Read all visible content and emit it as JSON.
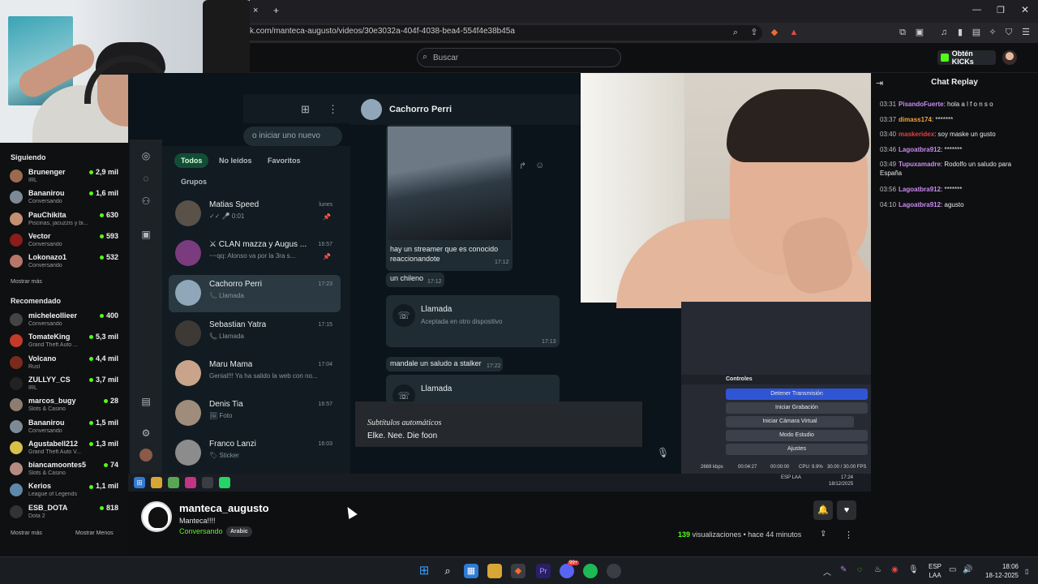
{
  "browser": {
    "url": "k.com/manteca-augusto/videos/30e3032a-404f-4038-bea4-554f4e38b45a",
    "tab_add": "+",
    "tab_close": "×"
  },
  "header": {
    "search_placeholder": "Buscar",
    "get_kicks": "Obtén KICKs"
  },
  "sidebar": {
    "following_title": "Siguiendo",
    "following": [
      {
        "name": "Brunenger",
        "sub": "IRL",
        "viewers": "2,9 mil",
        "color": "#9c6b4e"
      },
      {
        "name": "Bananirou",
        "sub": "Conversando",
        "viewers": "1,6 mil",
        "color": "#7d8a95"
      },
      {
        "name": "PauChikita",
        "sub": "Piscinas, jacuzzis y bi...",
        "viewers": "630",
        "color": "#c58f72"
      },
      {
        "name": "Vector",
        "sub": "Conversando",
        "viewers": "593",
        "color": "#8a1d1d"
      },
      {
        "name": "Lokonazo1",
        "sub": "Conversando",
        "viewers": "532",
        "color": "#b7766a"
      }
    ],
    "show_more_1": "Mostrar más",
    "recommended_title": "Recomendado",
    "recommended": [
      {
        "name": "micheleollieer",
        "sub": "Conversando",
        "viewers": "400",
        "color": "#444"
      },
      {
        "name": "TomateKing",
        "sub": "Grand Theft Auto ...",
        "viewers": "5,3 mil",
        "color": "#c23b2a"
      },
      {
        "name": "Volcano",
        "sub": "Rust",
        "viewers": "4,4 mil",
        "color": "#7a2b1c"
      },
      {
        "name": "ZULLYY_CS",
        "sub": "IRL",
        "viewers": "3,7 mil",
        "color": "#222"
      },
      {
        "name": "marcos_bugy",
        "sub": "Slots & Casino",
        "viewers": "28",
        "color": "#8c7d70"
      },
      {
        "name": "Bananirou",
        "sub": "Conversando",
        "viewers": "1,5 mil",
        "color": "#7d8a95"
      },
      {
        "name": "Agustabell212",
        "sub": "Grand Theft Auto V...",
        "viewers": "1,3 mil",
        "color": "#d8c04a"
      },
      {
        "name": "biancamoontes5",
        "sub": "Slots & Casino",
        "viewers": "74",
        "color": "#b58a83"
      },
      {
        "name": "Kerios",
        "sub": "League of Legends",
        "viewers": "1,1 mil",
        "color": "#5f87a8"
      },
      {
        "name": "ESB_DOTA",
        "sub": "Dota 2",
        "viewers": "818",
        "color": "#333"
      }
    ],
    "show_more_2": "Mostrar más",
    "show_less": "Mostrar Menos"
  },
  "whatsapp": {
    "search_placeholder": "o iniciar uno nuevo",
    "filters": [
      "Todos",
      "No leídos",
      "Favoritos",
      "Grupos"
    ],
    "conversations": [
      {
        "name": "Matias Speed",
        "msg": "✓✓ 🎤 0:01",
        "time": "lunes",
        "color": "#5a5148"
      },
      {
        "name": "⚔ CLAN mazza y  Augus ...",
        "msg": "~~qq: Alonso va por la 3ra s...",
        "time": "16:57",
        "color": "#7a3c7e"
      },
      {
        "name": "Cachorro Perri",
        "msg": "📞 Llamada",
        "time": "17:23",
        "color": "#8fa7b8"
      },
      {
        "name": "Sebastian Yatra",
        "msg": "📞 Llamada",
        "time": "17:15",
        "color": "#3d3a36"
      },
      {
        "name": "Maru Mama",
        "msg": "Genial!!! Ya ha salido la web con no...",
        "time": "17:04",
        "color": "#c9a48a"
      },
      {
        "name": "Denis Tia",
        "msg": "🖼 Foto",
        "time": "16:57",
        "color": "#a08c7a"
      },
      {
        "name": "Franco Lanzi",
        "msg": "🏷 Sticker",
        "time": "16:03",
        "color": "#8c8c8c"
      }
    ],
    "chat_name": "Cachorro Perri",
    "messages": {
      "caption": "hay un streamer que es conocido",
      "caption2": "reaccionandote",
      "caption_time": "17:12",
      "m1": "un chileno",
      "m1_time": "17:12",
      "call1_title": "Llamada",
      "call1_sub": "Aceptada en otro dispositivo",
      "call1_time": "17:13",
      "m2": "mandale un saludo a stalker",
      "m2_time": "17:22",
      "call2_title": "Llamada"
    }
  },
  "subtitles": {
    "title": "Subtítulos automáticos",
    "text": "Elke. Nee. Die foon"
  },
  "obs": {
    "panel": "Controles",
    "buttons": [
      "Detener Transmisión",
      "Iniciar Grabación",
      "Iniciar Cámara Virtual",
      "Modo Estudio",
      "Ajustes"
    ],
    "status": {
      "kbps": "2669 kbps",
      "time1": "00:04:27",
      "time2": "00:00:00",
      "cpu": "CPU: 9.9%",
      "fps": "30.00 / 30.00 FPS"
    },
    "lang": "ESP LAA",
    "clock": "17:24",
    "date": "18/12/2025"
  },
  "chat": {
    "title": "Chat Replay",
    "messages": [
      {
        "time": "03:31",
        "user": "PisandoFuerte",
        "color": "#c88cf0",
        "text": ": hola a l f o n s o"
      },
      {
        "time": "03:37",
        "user": "dimass174",
        "color": "#f2a23b",
        "text": ": *******"
      },
      {
        "time": "03:40",
        "user": "maskeridex",
        "color": "#e8403b",
        "text": ": soy maske un gusto"
      },
      {
        "time": "03:46",
        "user": "Lagoatbra912",
        "color": "#c88cf0",
        "text": ": *******"
      },
      {
        "time": "03:49",
        "user": "Tupuxamadre",
        "color": "#c88cf0",
        "text": ": Rodolfo un saludo para España"
      },
      {
        "time": "03:56",
        "user": "Lagoatbra912",
        "color": "#c88cf0",
        "text": ": *******"
      },
      {
        "time": "04:10",
        "user": "Lagoatbra912",
        "color": "#c88cf0",
        "text": ": agusto"
      }
    ]
  },
  "channel": {
    "name": "manteca_augusto",
    "title": "Manteca!!!!",
    "category": "Conversando",
    "tag": "Arabic",
    "views_count": "139",
    "views_label": "visualizaciones",
    "ago": "hace 44 minutos"
  },
  "taskbar": {
    "lang1": "ESP",
    "lang2": "LAA",
    "time": "18:06",
    "date": "18-12-2025",
    "badge": "99+"
  },
  "colors": {
    "kick_green": "#53fc18",
    "whatsapp_dark": "#111b21",
    "obs_blue": "#2f55d4"
  }
}
